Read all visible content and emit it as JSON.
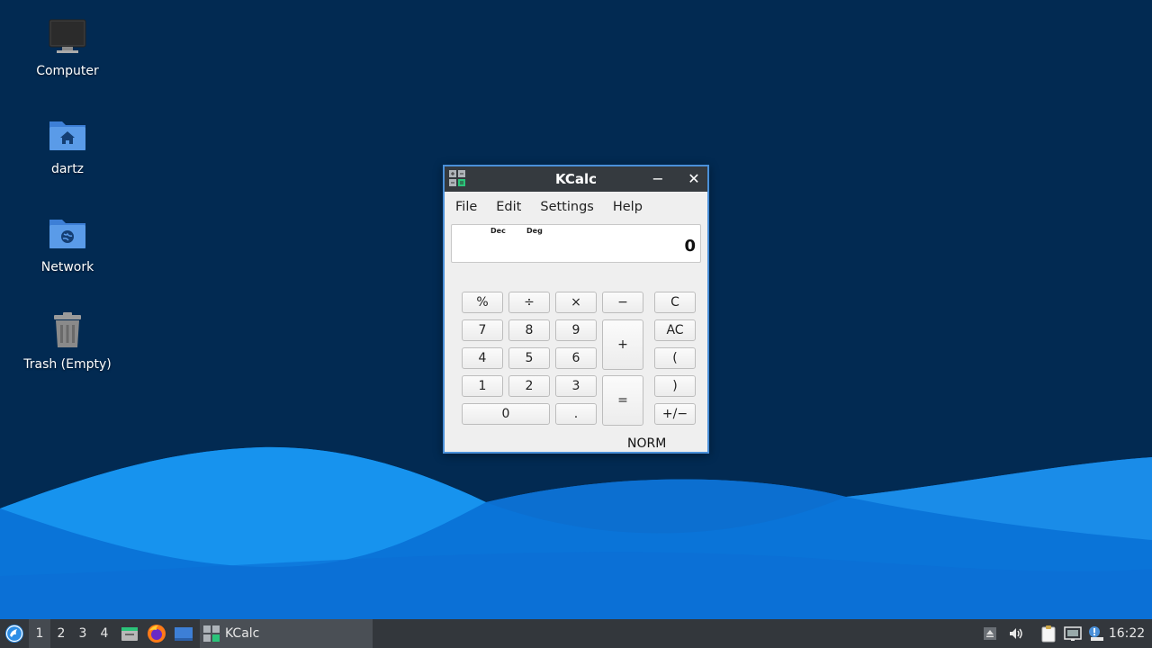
{
  "desktop": {
    "icons": [
      {
        "label": "Computer",
        "icon": "computer-icon"
      },
      {
        "label": "dartz",
        "icon": "home-folder-icon"
      },
      {
        "label": "Network",
        "icon": "network-folder-icon"
      },
      {
        "label": "Trash (Empty)",
        "icon": "trash-icon"
      }
    ]
  },
  "window": {
    "title": "KCalc",
    "minimize_label": "−",
    "close_label": "✕",
    "menu": [
      "File",
      "Edit",
      "Settings",
      "Help"
    ],
    "display": {
      "base": "Dec",
      "angle": "Deg",
      "value": "0"
    },
    "keys": {
      "percent": "%",
      "divide": "÷",
      "multiply": "×",
      "minus": "−",
      "clear": "C",
      "seven": "7",
      "eight": "8",
      "nine": "9",
      "plus": "+",
      "all_clear": "AC",
      "four": "4",
      "five": "5",
      "six": "6",
      "open_paren": "(",
      "one": "1",
      "two": "2",
      "three": "3",
      "equals": "=",
      "close_paren": ")",
      "zero": "0",
      "decimal": ".",
      "sign": "+/−"
    },
    "status": "NORM"
  },
  "taskbar": {
    "workspaces": [
      "1",
      "2",
      "3",
      "4"
    ],
    "active_workspace": "1",
    "launchers": [
      "file-manager-icon",
      "firefox-icon",
      "show-desktop-icon"
    ],
    "tasks": [
      {
        "label": "KCalc",
        "icon": "kcalc-icon"
      }
    ],
    "tray": [
      "eject-icon",
      "volume-icon",
      "clipboard-icon",
      "network-icon",
      "notification-icon"
    ],
    "clock": "16:22"
  },
  "colors": {
    "desktop_bg": "#022a52",
    "window_accent": "#4a90d9",
    "titlebar": "#353a3f",
    "taskbar": "#33373c"
  }
}
